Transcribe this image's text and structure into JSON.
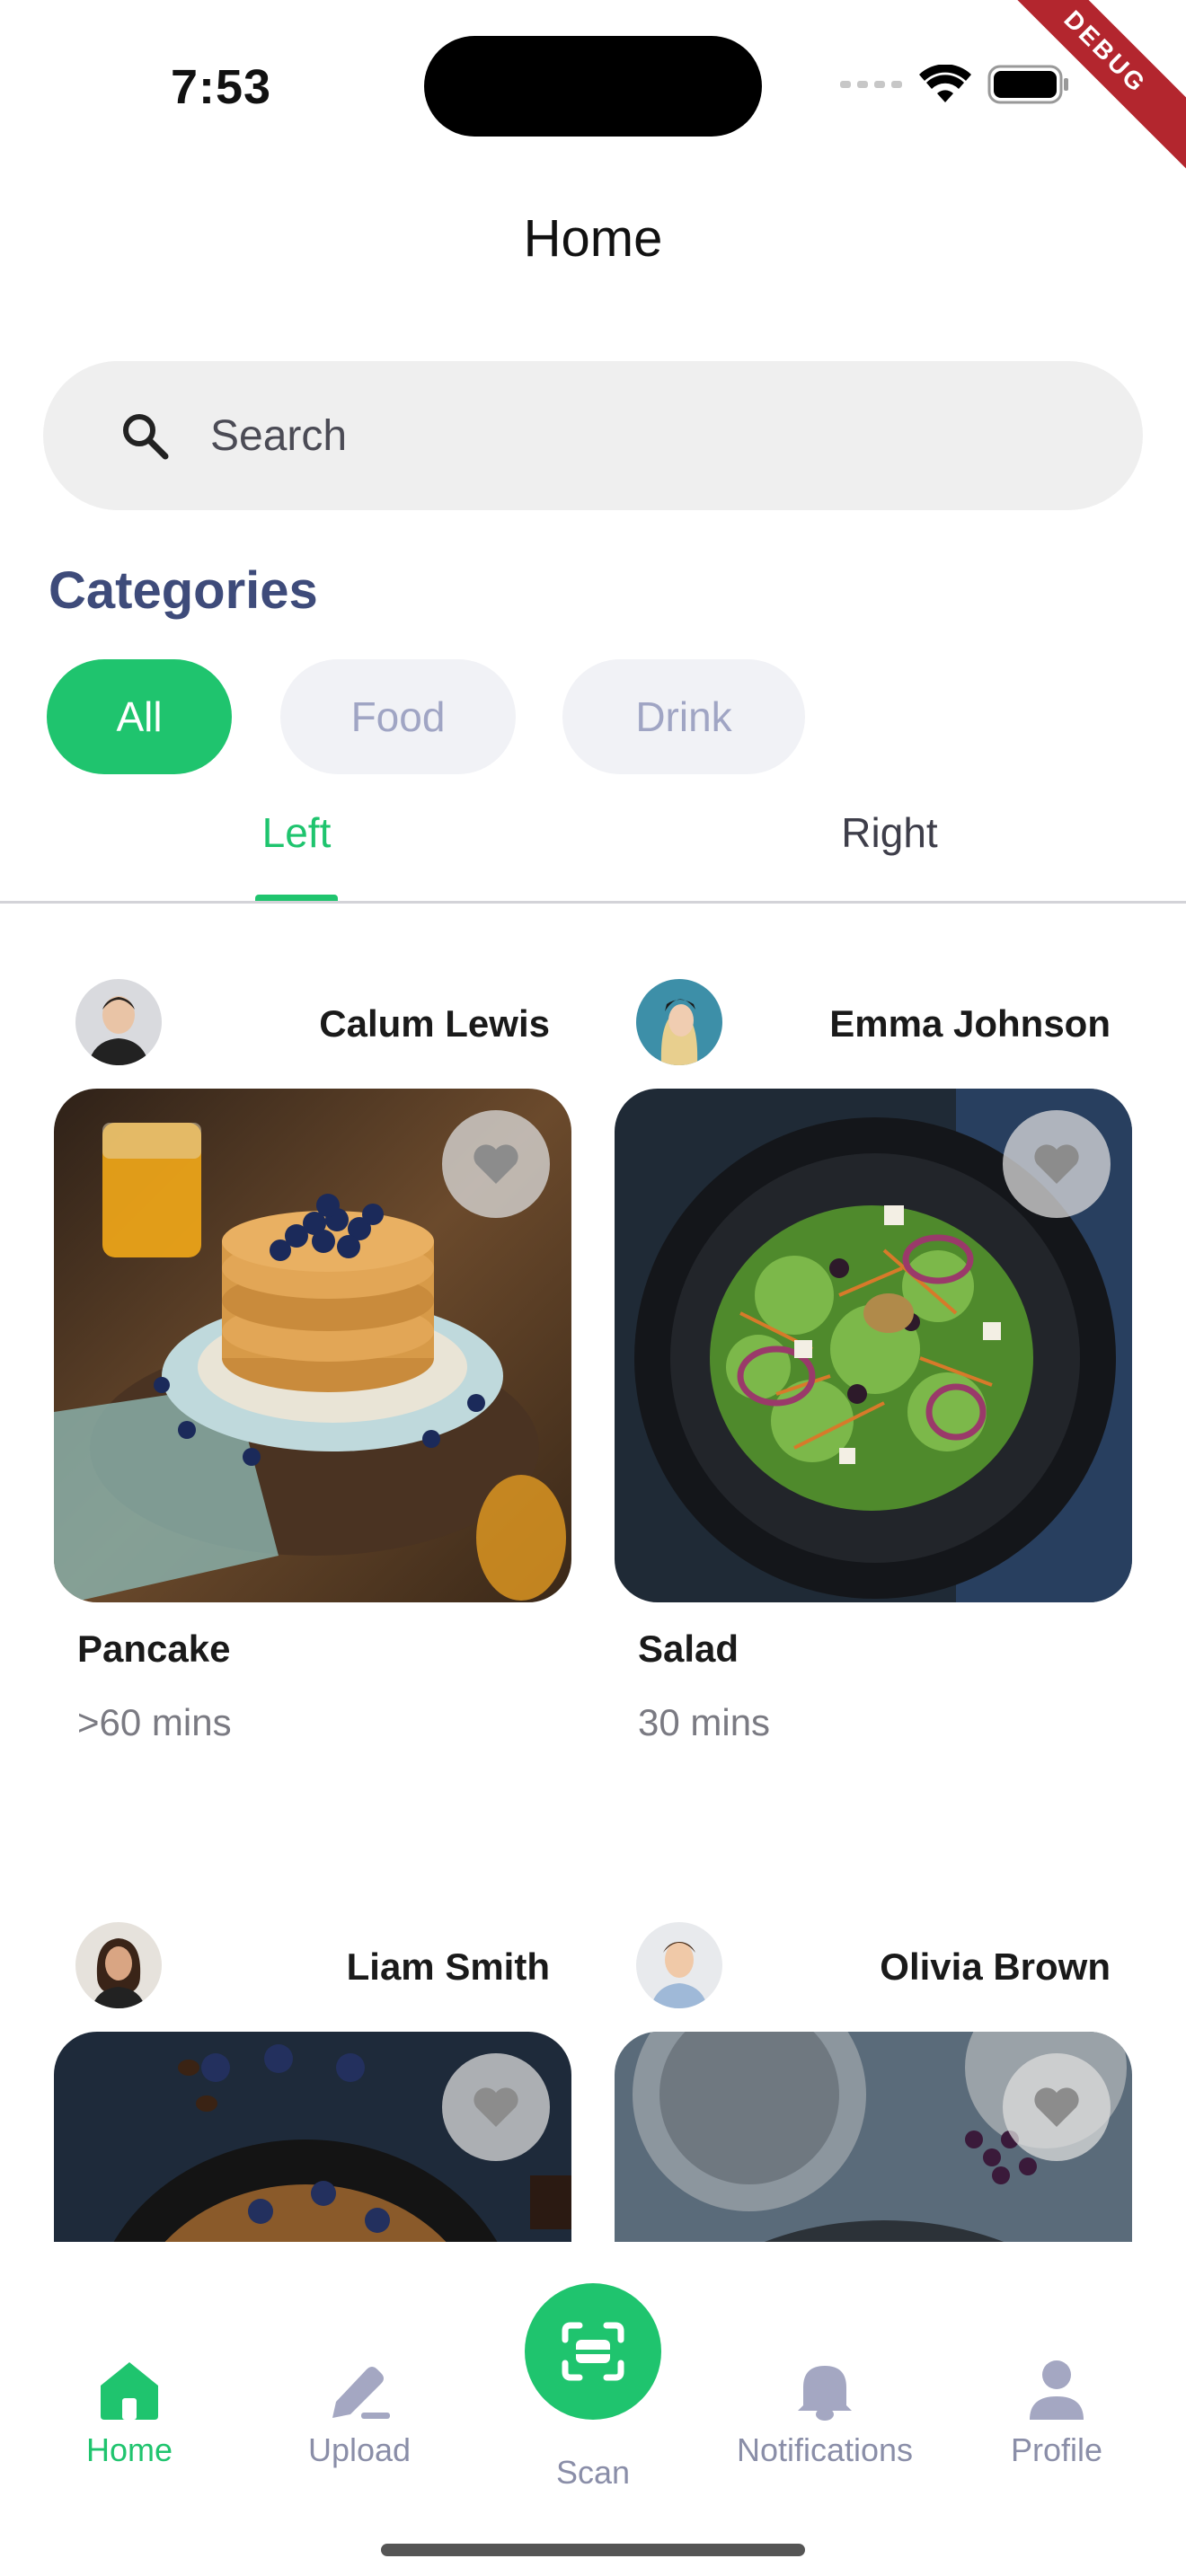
{
  "status_bar": {
    "time": "7:53",
    "debug_label": "DEBUG"
  },
  "header": {
    "title": "Home"
  },
  "search": {
    "placeholder": "Search"
  },
  "categories": {
    "heading": "Categories",
    "items": [
      {
        "label": "All",
        "active": true
      },
      {
        "label": "Food",
        "active": false
      },
      {
        "label": "Drink",
        "active": false
      }
    ]
  },
  "tabs": [
    {
      "label": "Left",
      "active": true
    },
    {
      "label": "Right",
      "active": false
    }
  ],
  "recipes": [
    {
      "author": "Calum Lewis",
      "name": "Pancake",
      "time": ">60 mins"
    },
    {
      "author": "Emma Johnson",
      "name": "Salad",
      "time": "30 mins"
    },
    {
      "author": "Liam Smith",
      "name": "",
      "time": ""
    },
    {
      "author": "Olivia Brown",
      "name": "",
      "time": ""
    }
  ],
  "bottom_nav": {
    "items": [
      {
        "label": "Home",
        "icon": "home-icon",
        "active": true
      },
      {
        "label": "Upload",
        "icon": "pencil-icon",
        "active": false
      },
      {
        "label": "Scan",
        "icon": "scan-icon",
        "active": false
      },
      {
        "label": "Notifications",
        "icon": "bell-icon",
        "active": false
      },
      {
        "label": "Profile",
        "icon": "person-icon",
        "active": false
      }
    ]
  },
  "colors": {
    "accent": "#1fc46e",
    "heading": "#3e4b7a",
    "inactive": "#a0a5c4"
  }
}
